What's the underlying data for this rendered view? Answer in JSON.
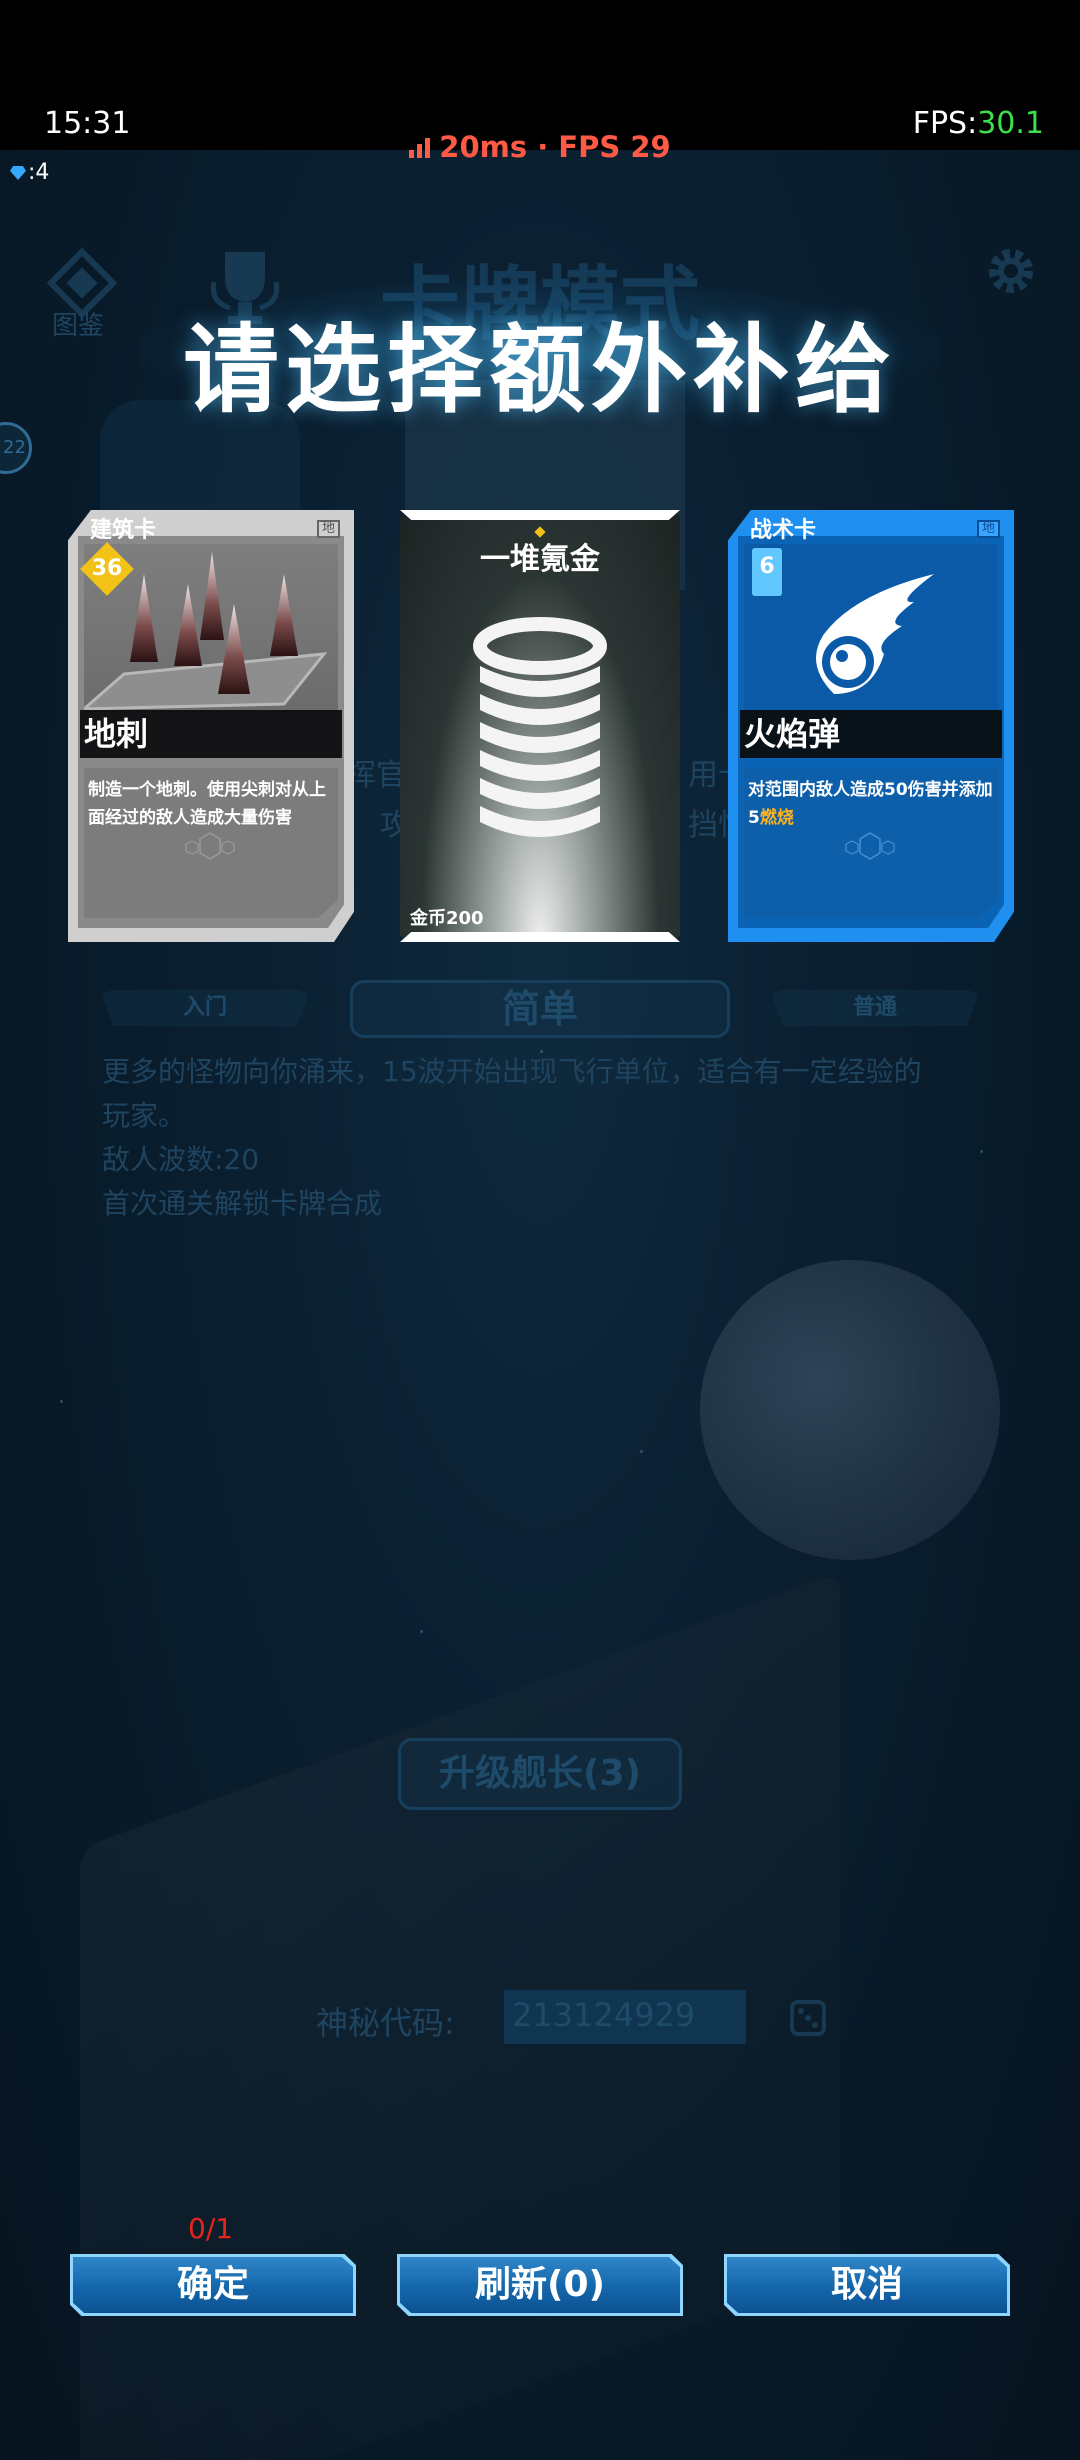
{
  "status_bar": {
    "time": "15:31",
    "fps_label": "FPS:",
    "fps_value": "30.1",
    "network": "20ms · FPS 29",
    "gems": ":4"
  },
  "background": {
    "title": "卡牌模式",
    "codex_label": "图鉴",
    "level_badge": "22",
    "difficulty_left": "入门",
    "difficulty_current": "简单",
    "difficulty_right": "普通",
    "description_line1": "更多的怪物向你涌来，15波开始出现飞行单位，适合有一定经验的",
    "description_line2": "玩家。",
    "enemy_waves": "敌人波数:20",
    "unlock_text": "首次通关解锁卡牌合成",
    "upgrade_button": "升级舰长(3)",
    "code_label": "神秘代码:",
    "code_value": "213124929",
    "fragment1": "挥官",
    "fragment2": "攻击",
    "fragment3": "用卡",
    "fragment4": "挡怪"
  },
  "overlay": {
    "heading": "请选择额外补给"
  },
  "cards": [
    {
      "type": "建筑卡",
      "tag": "地",
      "cost": "36",
      "name": "地刺",
      "description": "制造一个地刺。使用尖刺对从上面经过的敌人造成大量伤害",
      "icon": "spikes-icon",
      "frame_color": "#cfcfcf"
    },
    {
      "name": "一堆氪金",
      "price": "金币200",
      "icon": "coin-stack-icon"
    },
    {
      "type": "战术卡",
      "tag": "地",
      "cost": "6",
      "name": "火焰弹",
      "description_prefix": "对范围内敌人造成50伤害并添加5",
      "description_highlight": "燃烧",
      "icon": "fireball-icon",
      "frame_color": "#1f8ff0",
      "highlight_color": "#ffb11f"
    }
  ],
  "footer": {
    "selection_counter": "0/1",
    "confirm": "确定",
    "refresh": "刷新(0)",
    "cancel": "取消"
  }
}
